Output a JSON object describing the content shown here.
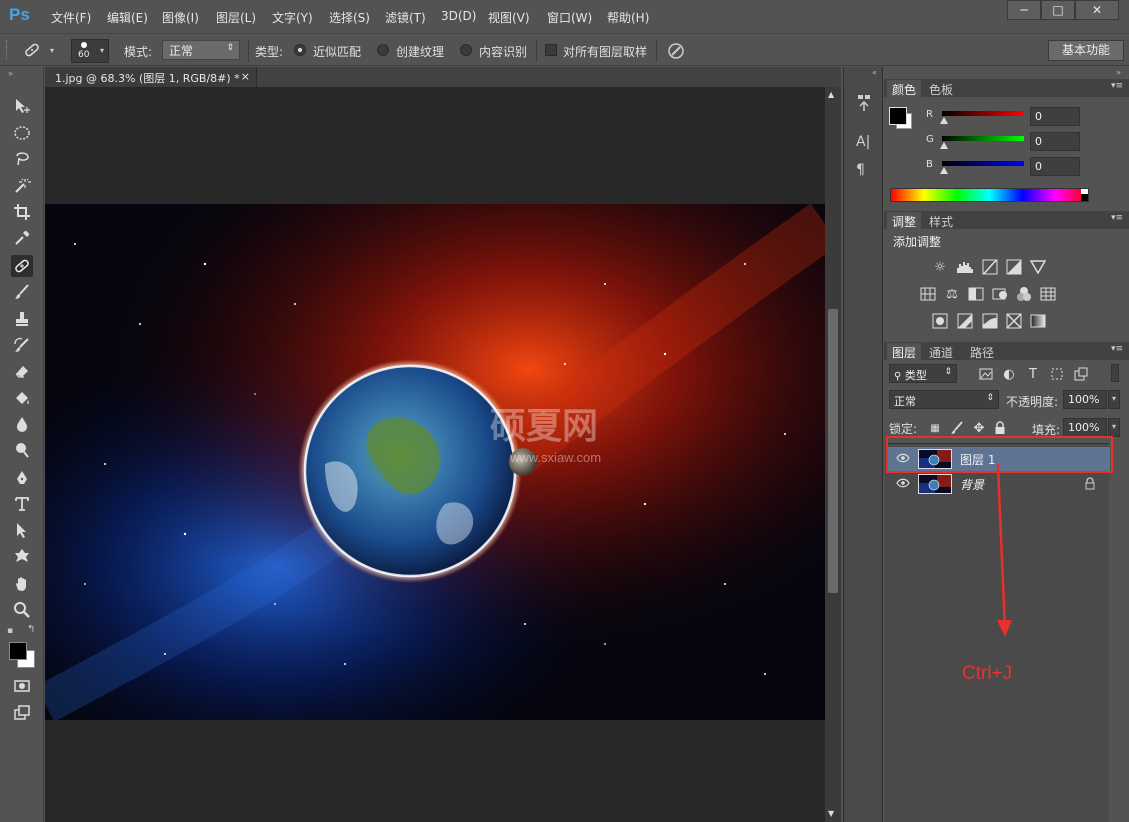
{
  "app": {
    "logo": "Ps"
  },
  "menu": [
    "文件(F)",
    "编辑(E)",
    "图像(I)",
    "图层(L)",
    "文字(Y)",
    "选择(S)",
    "滤镜(T)",
    "3D(D)",
    "视图(V)",
    "窗口(W)",
    "帮助(H)"
  ],
  "window_controls": {
    "minimize": "─",
    "maximize": "□",
    "close": "✕"
  },
  "options": {
    "brush_size": "60",
    "mode_label": "模式:",
    "mode_value": "正常",
    "type_label": "类型:",
    "radio1": "近似匹配",
    "radio2": "创建纹理",
    "radio3": "内容识别",
    "sample_all": "对所有图层取样",
    "workspace": "基本功能"
  },
  "document": {
    "tab_title": "1.jpg @ 68.3% (图层 1, RGB/8#) *",
    "tab_close": "×",
    "watermark_cn": "硕夏网",
    "watermark_url": "www.sxiaw.com"
  },
  "color_panel": {
    "tabs": [
      "颜色",
      "色板"
    ],
    "channels": [
      {
        "label": "R",
        "value": "0",
        "color": "#e02020"
      },
      {
        "label": "G",
        "value": "0",
        "color": "#20c020"
      },
      {
        "label": "B",
        "value": "0",
        "color": "#2040e0"
      }
    ]
  },
  "adjust_panel": {
    "tabs": [
      "调整",
      "样式"
    ],
    "title": "添加调整"
  },
  "layers_panel": {
    "tabs": [
      "图层",
      "通道",
      "路径"
    ],
    "filter_kind": "类型",
    "blend_mode": "正常",
    "opacity_label": "不透明度:",
    "opacity_value": "100%",
    "lock_label": "锁定:",
    "fill_label": "填充:",
    "fill_value": "100%",
    "layers": [
      {
        "name": "图层 1",
        "selected": true
      },
      {
        "name": "背景",
        "selected": false,
        "locked": true
      }
    ]
  },
  "annotation": {
    "text": "Ctrl+J",
    "color": "#e8312a"
  }
}
